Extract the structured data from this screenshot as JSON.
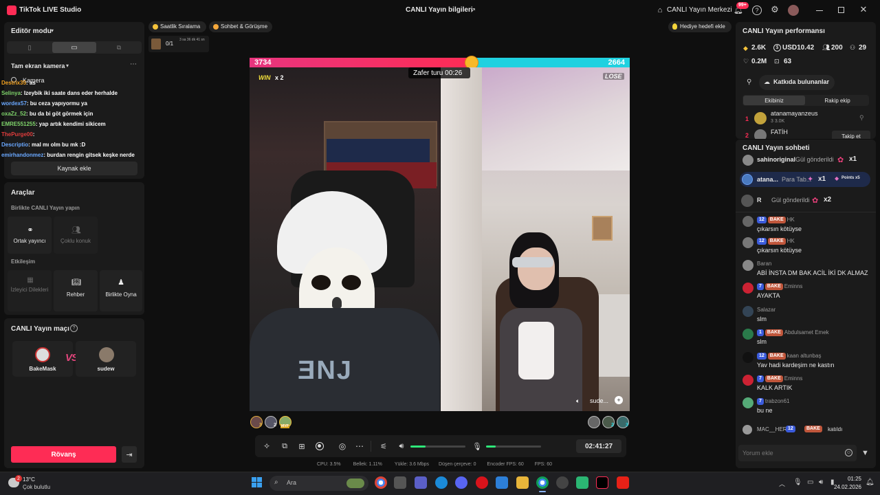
{
  "titlebar": {
    "app_title": "TikTok LIVE Studio",
    "center_title": "CANLI Yayın bilgileri",
    "live_center": "CANLI Yayın Merkezi",
    "notif_count": "99+"
  },
  "left": {
    "editor_mode": "Editör modu",
    "scene": "Tam ekran kamera",
    "camera_label": "Kamera",
    "chat_overlay": [
      {
        "user": "Destrix35",
        "text": ": as",
        "color": "#f0a020"
      },
      {
        "user": "Selinya",
        "text": ": Izeybik iki saate dans eder herhalde",
        "color": "#7fd46b"
      },
      {
        "user": "wordex57",
        "text": ": bu ceza yapıyormu ya",
        "color": "#6aa8ff"
      },
      {
        "user": "oxaZz_52",
        "text": ": bu da bi göt görmek için",
        "color": "#7fd46b"
      },
      {
        "user": "EMRE551255",
        "text": ": yap artık kendimi sikicem",
        "color": "#7fd46b"
      },
      {
        "user": "ThePurge00",
        "text": ": ",
        "color": "#e03c3c"
      },
      {
        "user": "Descriptio",
        "text": ": mal mı olm bu mk :D",
        "color": "#6aa8ff"
      },
      {
        "user": "emirhandonmez",
        "text": ": burdan rengin gitsek keşke nerde",
        "color": "#6aa8ff"
      }
    ],
    "add_source": "Kaynak ekle",
    "tools_title": "Araçlar",
    "together_title": "Birlikte CANLI Yayın yapın",
    "cohost": "Ortak yayıncı",
    "multi_guest": "Çoklu konuk",
    "interaction_title": "Etkileşim",
    "viewer_requests": "İzleyici Dilekleri",
    "guide": "Rehber",
    "play_together": "Birlikte Oyna",
    "match_title": "CANLI Yayın maçı",
    "player1": "BakeMask",
    "player2": "sudew",
    "vs": "VS",
    "rematch": "Rövanş"
  },
  "stage": {
    "ranking_pill": "Saatlik Sıralama",
    "chat_pill": "Sohbet & Görüşme",
    "gift_goal": "Hediye hedefi ekle",
    "goal_progress": "0/1",
    "goal_time": "3 sa 36 dk 41 sn",
    "score_left": "3734",
    "score_right": "2664",
    "score_left_share": 0.5837,
    "win_label": "WIN",
    "win_mult": "x 2",
    "lose_label": "LOSE",
    "victory_timer": "Zafer turu 00:26",
    "right_name": "sude...",
    "left_rank_nums": [
      "3",
      "2",
      "MVP"
    ],
    "right_rank_nums": [
      "",
      "2",
      "3"
    ],
    "stream_time": "02:41:27",
    "volume_level": 0.28,
    "mic_level": 0.18
  },
  "stats": {
    "cpu": "CPU:  3.5%",
    "memory": "Bellek:  1.11%",
    "upload": "Yükle:  3.6 Mbps",
    "dropped": "Düşen çerçeve:  0",
    "encoder_fps": "Encoder FPS:  60",
    "fps": "FPS:  60"
  },
  "right": {
    "perf_title": "CANLI Yayın performansı",
    "diamonds": "2.6K",
    "usd": "USD10.42",
    "viewers": "200",
    "new_followers": "29",
    "likes": "0.2M",
    "gifters": "63",
    "contributors_btn": "Katkıda bulunanlar",
    "tab_team": "Ekibiniz",
    "tab_rival": "Rakip ekip",
    "rank1_pos": "1",
    "rank1_name": "atanamayanzeus",
    "rank1_meta": "3  3.0K",
    "rank2_pos": "2",
    "rank2_name": "FATİH",
    "follow_btn": "Takip et",
    "chat_title": "CANLI Yayın sohbeti",
    "gift1_user": "sahinoriginal",
    "gift1_text": "Gül gönderildi",
    "gift1_mult": "x1",
    "gift2_user": "atana...",
    "gift2_text": "Para Tab...",
    "gift2_mult": "x1",
    "gift2_points": "Points x5",
    "gift3_user": "R",
    "gift3_text": "Gül gönderildi",
    "gift3_mult": "x2",
    "messages": [
      {
        "lvl": "12",
        "badge": "BAKE",
        "user": "HK",
        "text": "çıkarsın kötüyse",
        "av": "#666"
      },
      {
        "lvl": "12",
        "badge": "BAKE",
        "user": "HK",
        "text": "çıkarsın kötüyse",
        "av": "#777"
      },
      {
        "lvl": "",
        "badge": "",
        "user": "Baran",
        "text": "ABİ İNSTA DM BAK ACİL İKİ DK ALMAZ",
        "av": "#888"
      },
      {
        "lvl": "7",
        "badge": "BAKE",
        "user": "Eminns",
        "text": "AYAKTA",
        "av": "#c23"
      },
      {
        "lvl": "",
        "badge": "",
        "user": "Salazar",
        "text": "slm",
        "av": "#345"
      },
      {
        "lvl": "1",
        "badge": "BAKE",
        "user": "Abdulsamet Emek",
        "text": "slm",
        "av": "#2a7a4a"
      },
      {
        "lvl": "12",
        "badge": "BAKE",
        "user": "kaan altunbaş",
        "text": "Yav hadi kardeşim ne kastın",
        "av": "#111"
      },
      {
        "lvl": "7",
        "badge": "BAKE",
        "user": "Eminns",
        "text": "KALK ARTIK",
        "av": "#c23"
      },
      {
        "lvl": "7",
        "badge": "",
        "user": "trabzon61",
        "text": "bu ne",
        "av": "#5a7"
      }
    ],
    "join_user": "MAC__HER",
    "join_lvl": "12",
    "join_badge": "BAKE",
    "join_text": "katıldı",
    "comment_placeholder": "Yorum ekle"
  },
  "taskbar": {
    "temp": "13°C",
    "weather": "Çok bulutlu",
    "weather_badge": "2",
    "search": "Ara",
    "time": "01:25",
    "date": "24.02.2026"
  }
}
